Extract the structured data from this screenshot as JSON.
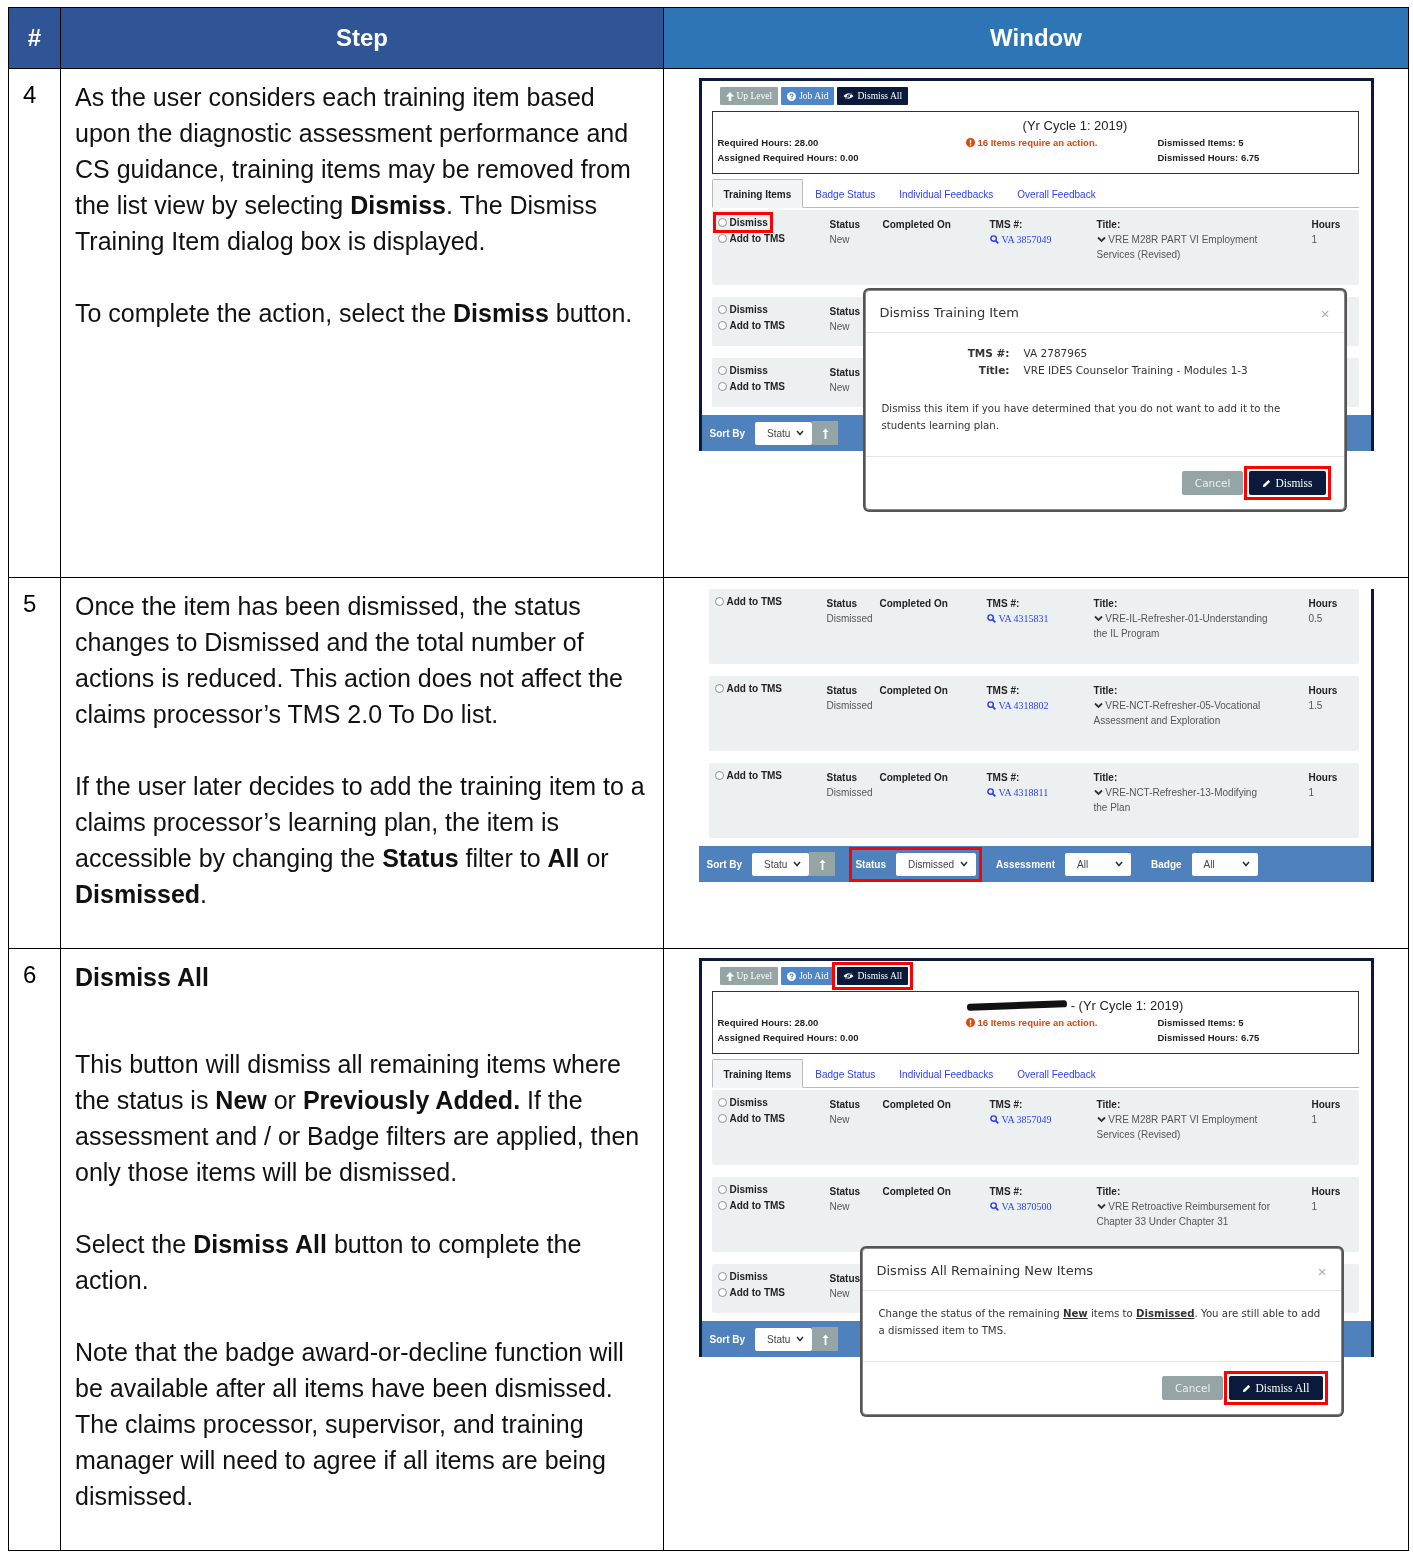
{
  "columns": [
    {
      "label": "#"
    },
    {
      "label": "Step"
    },
    {
      "label": "Window"
    }
  ],
  "rows": [
    {
      "number": "4",
      "step": [
        {
          "kind": "text",
          "text": "As the user considers each training item based upon the diagnostic assessment performance and CS guidance, training items may be removed from the list view by selecting **Dismiss**. The Dismiss Training Item dialog box is displayed."
        },
        {
          "kind": "text",
          "text": "To complete the action, select the **Dismiss** button."
        }
      ],
      "screen": {
        "toolbar": [
          {
            "kind": "up",
            "label": "Up Level",
            "highlighted": false
          },
          {
            "kind": "help",
            "label": "Job Aid",
            "highlighted": false
          },
          {
            "kind": "dismiss",
            "label": "Dismiss All",
            "highlighted": false
          }
        ],
        "summary": {
          "redacted": false,
          "title": "(Yr Cycle 1: 2019)",
          "required": "Required Hours: 28.00",
          "assigned": "Assigned Required Hours: 0.00",
          "alert": "16 Items require an action.",
          "dismissed_items": "Dismissed Items: 5",
          "dismissed_hours": "Dismissed Hours: 6.75"
        },
        "tabs": [
          {
            "label": "Training Items",
            "selected": true
          },
          {
            "label": "Badge Status",
            "selected": false
          },
          {
            "label": "Individual Feedbacks",
            "selected": false
          },
          {
            "label": "Overall Feedback",
            "selected": false
          }
        ],
        "items": [
          {
            "options": [
              {
                "label": "Dismiss",
                "selected": false,
                "highlighted": true
              },
              {
                "label": "Add to TMS",
                "selected": false,
                "highlighted": false
              }
            ],
            "fields": [
              {
                "kind": "status",
                "label": "Status",
                "value": "New"
              },
              {
                "kind": "completed",
                "label": "Completed On"
              },
              {
                "kind": "tms",
                "label": "TMS #:",
                "value": "VA 3857049"
              },
              {
                "kind": "title",
                "label": "Title:",
                "value": "VRE M28R PART VI Employment Services (Revised)"
              },
              {
                "kind": "hours",
                "label": "Hours",
                "value": "1"
              }
            ]
          },
          {
            "options": [
              {
                "label": "Dismiss",
                "selected": false,
                "highlighted": false
              },
              {
                "label": "Add to TMS",
                "selected": false,
                "highlighted": false
              }
            ],
            "fields": [
              {
                "kind": "status",
                "label": "Status",
                "value": "New"
              }
            ]
          },
          {
            "options": [
              {
                "label": "Dismiss",
                "selected": false,
                "highlighted": false
              },
              {
                "label": "Add to TMS",
                "selected": false,
                "highlighted": false
              }
            ],
            "fields": [
              {
                "kind": "status",
                "label": "Status",
                "value": "New"
              }
            ]
          }
        ],
        "filter_bar": [
          {
            "highlighted": false,
            "controls": [
              {
                "kind": "label",
                "text": "Sort By"
              },
              {
                "kind": "select",
                "value": "Statu"
              },
              {
                "kind": "order"
              }
            ]
          }
        ],
        "dialog": {
          "title": "Dismiss Training Item",
          "close": "×",
          "fields": [
            {
              "label": "TMS #:",
              "value": "VA 2787965"
            },
            {
              "label": "Title:",
              "value": "VRE IDES Counselor Training - Modules 1-3"
            }
          ],
          "message": "Dismiss this item if you have determined that you do not want to add it to the students learning plan.",
          "buttons": [
            {
              "kind": "cancel",
              "label": "Cancel",
              "highlighted": false
            },
            {
              "kind": "primary",
              "label": "Dismiss",
              "highlighted": true
            }
          ]
        }
      }
    },
    {
      "number": "5",
      "step": [
        {
          "kind": "text",
          "text": "Once the item has been dismissed, the status changes to Dismissed and the total number of actions is reduced. This action does not affect the claims processor’s TMS 2.0 To Do list."
        },
        {
          "kind": "text",
          "text": "If the user later decides to add the training item to a claims processor’s learning plan, the item is accessible by changing the **Status** filter to **All** or **Dismissed**."
        }
      ],
      "screen": {
        "items": [
          {
            "options": [
              {
                "label": "Add to TMS",
                "selected": false,
                "highlighted": false
              }
            ],
            "fields": [
              {
                "kind": "status",
                "label": "Status",
                "value": "Dismissed"
              },
              {
                "kind": "completed",
                "label": "Completed On"
              },
              {
                "kind": "tms",
                "label": "TMS #:",
                "value": "VA 4315831"
              },
              {
                "kind": "title",
                "label": "Title:",
                "value": "VRE-IL-Refresher-01-Understanding the IL Program"
              },
              {
                "kind": "hours",
                "label": "Hours",
                "value": "0.5"
              }
            ]
          },
          {
            "options": [
              {
                "label": "Add to TMS",
                "selected": false,
                "highlighted": false
              }
            ],
            "fields": [
              {
                "kind": "status",
                "label": "Status",
                "value": "Dismissed"
              },
              {
                "kind": "completed",
                "label": "Completed On"
              },
              {
                "kind": "tms",
                "label": "TMS #:",
                "value": "VA 4318802"
              },
              {
                "kind": "title",
                "label": "Title:",
                "value": "VRE-NCT-Refresher-05-Vocational Assessment and Exploration"
              },
              {
                "kind": "hours",
                "label": "Hours",
                "value": "1.5"
              }
            ]
          },
          {
            "options": [
              {
                "label": "Add to TMS",
                "selected": false,
                "highlighted": false
              }
            ],
            "fields": [
              {
                "kind": "status",
                "label": "Status",
                "value": "Dismissed"
              },
              {
                "kind": "completed",
                "label": "Completed On"
              },
              {
                "kind": "tms",
                "label": "TMS #:",
                "value": "VA 4318811"
              },
              {
                "kind": "title",
                "label": "Title:",
                "value": "VRE-NCT-Refresher-13-Modifying the Plan"
              },
              {
                "kind": "hours",
                "label": "Hours",
                "value": "1"
              }
            ]
          }
        ],
        "filter_bar": [
          {
            "highlighted": false,
            "controls": [
              {
                "kind": "label",
                "text": "Sort By"
              },
              {
                "kind": "select",
                "value": "Statu"
              },
              {
                "kind": "order"
              }
            ]
          },
          {
            "highlighted": true,
            "controls": [
              {
                "kind": "label",
                "text": "Status"
              },
              {
                "kind": "select",
                "value": "Dismissed"
              }
            ]
          },
          {
            "highlighted": false,
            "controls": [
              {
                "kind": "label",
                "text": "Assessment"
              },
              {
                "kind": "select",
                "value": "All"
              }
            ]
          },
          {
            "highlighted": false,
            "controls": [
              {
                "kind": "label",
                "text": "Badge"
              },
              {
                "kind": "select",
                "value": "All"
              }
            ]
          }
        ]
      }
    },
    {
      "number": "6",
      "step": [
        {
          "kind": "heading",
          "text": "Dismiss All"
        },
        {
          "kind": "text",
          "text": "This button will dismiss all remaining items where the status is **New** or **Previously Added.** If the assessment and / or Badge filters are applied, then only those items will be dismissed."
        },
        {
          "kind": "text",
          "text": "Select the **Dismiss All** button to complete the action."
        },
        {
          "kind": "text",
          "text": "Note that the badge award-or-decline function will be available after all items have been dismissed. The claims processor, supervisor, and training manager will need to agree if all items are being dismissed."
        }
      ],
      "screen": {
        "toolbar": [
          {
            "kind": "up",
            "label": "Up Level",
            "highlighted": false
          },
          {
            "kind": "help",
            "label": "Job Aid",
            "highlighted": false
          },
          {
            "kind": "dismiss",
            "label": "Dismiss All",
            "highlighted": true
          }
        ],
        "summary": {
          "redacted": true,
          "title": "- (Yr Cycle 1: 2019)",
          "required": "Required Hours: 28.00",
          "assigned": "Assigned Required Hours: 0.00",
          "alert": "16 Items require an action.",
          "dismissed_items": "Dismissed Items: 5",
          "dismissed_hours": "Dismissed Hours: 6.75"
        },
        "tabs": [
          {
            "label": "Training Items",
            "selected": true
          },
          {
            "label": "Badge Status",
            "selected": false
          },
          {
            "label": "Individual Feedbacks",
            "selected": false
          },
          {
            "label": "Overall Feedback",
            "selected": false
          }
        ],
        "items": [
          {
            "options": [
              {
                "label": "Dismiss",
                "selected": false,
                "highlighted": false
              },
              {
                "label": "Add to TMS",
                "selected": false,
                "highlighted": false
              }
            ],
            "fields": [
              {
                "kind": "status",
                "label": "Status",
                "value": "New"
              },
              {
                "kind": "completed",
                "label": "Completed On"
              },
              {
                "kind": "tms",
                "label": "TMS #:",
                "value": "VA 3857049"
              },
              {
                "kind": "title",
                "label": "Title:",
                "value": "VRE M28R PART VI Employment Services (Revised)"
              },
              {
                "kind": "hours",
                "label": "Hours",
                "value": "1"
              }
            ]
          },
          {
            "options": [
              {
                "label": "Dismiss",
                "selected": false,
                "highlighted": false
              },
              {
                "label": "Add to TMS",
                "selected": false,
                "highlighted": false
              }
            ],
            "fields": [
              {
                "kind": "status",
                "label": "Status",
                "value": "New"
              },
              {
                "kind": "completed",
                "label": "Completed On"
              },
              {
                "kind": "tms",
                "label": "TMS #:",
                "value": "VA 3870500"
              },
              {
                "kind": "title",
                "label": "Title:",
                "value": "VRE Retroactive Reimbursement for Chapter 33 Under Chapter 31"
              },
              {
                "kind": "hours",
                "label": "Hours",
                "value": "1"
              }
            ]
          },
          {
            "options": [
              {
                "label": "Dismiss",
                "selected": false,
                "highlighted": false
              },
              {
                "label": "Add to TMS",
                "selected": false,
                "highlighted": false
              }
            ],
            "fields": [
              {
                "kind": "status",
                "label": "Status",
                "value": "New"
              }
            ]
          }
        ],
        "filter_bar": [
          {
            "highlighted": false,
            "controls": [
              {
                "kind": "label",
                "text": "Sort By"
              },
              {
                "kind": "select",
                "value": "Statu"
              },
              {
                "kind": "order"
              }
            ]
          }
        ],
        "dialog": {
          "title": "Dismiss All Remaining New Items",
          "close": "×",
          "message": "Change the status of the remaining **New** items to **Dismissed**. You are still able to add a dismissed item to TMS.",
          "buttons": [
            {
              "kind": "cancel",
              "label": "Cancel",
              "highlighted": false
            },
            {
              "kind": "primary",
              "label": "Dismiss All",
              "highlighted": true
            }
          ]
        }
      }
    }
  ]
}
